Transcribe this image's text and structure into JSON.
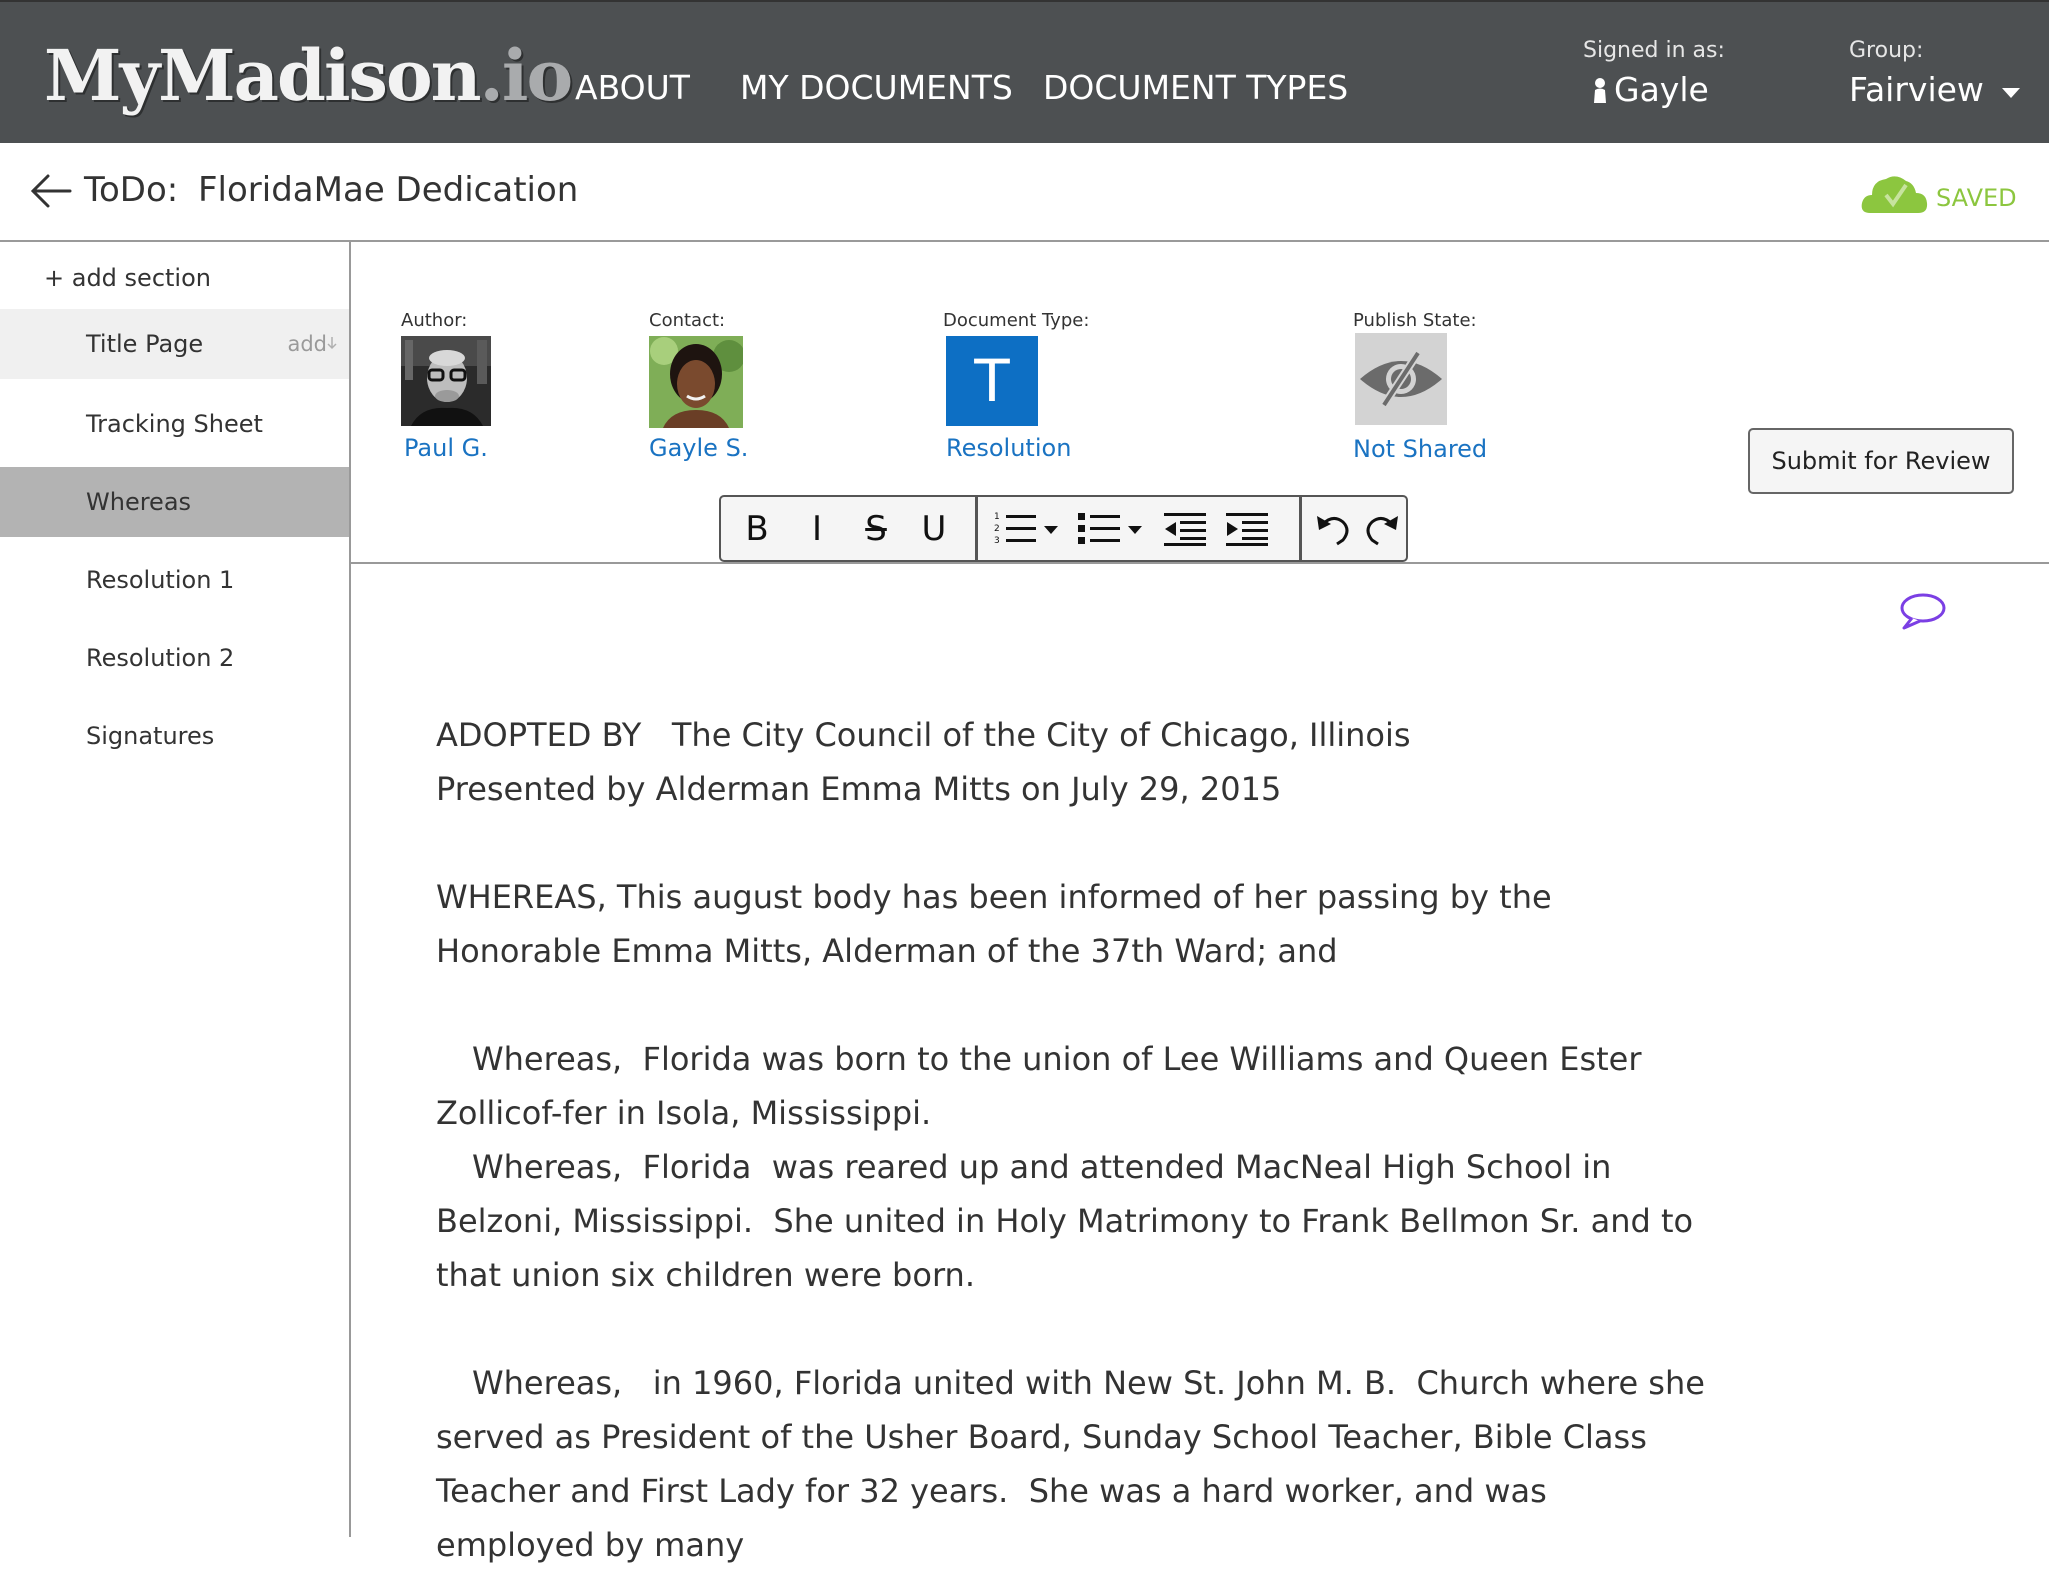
{
  "app": {
    "logo_main": "MyMadison",
    "logo_tld": ".io"
  },
  "nav": {
    "about": "ABOUT",
    "my_documents": "MY DOCUMENTS",
    "document_types": "DOCUMENT TYPES"
  },
  "account": {
    "signed_in_label": "Signed in as:",
    "user_name": "Gayle",
    "group_label": "Group:",
    "group_value": "Fairview"
  },
  "header": {
    "todo_label": "ToDo:",
    "doc_title": "FloridaMae Dedication",
    "save_status": "SAVED"
  },
  "sidebar": {
    "add_section": "+ add section",
    "items": [
      {
        "label": "Title Page",
        "add": "add"
      },
      {
        "label": "Tracking Sheet"
      },
      {
        "label": "Whereas"
      },
      {
        "label": "Resolution 1"
      },
      {
        "label": "Resolution 2"
      },
      {
        "label": "Signatures"
      }
    ]
  },
  "meta": {
    "author_label": "Author:",
    "author_name": "Paul G.",
    "contact_label": "Contact:",
    "contact_name": "Gayle S.",
    "doctype_label": "Document Type:",
    "doctype_letter": "T",
    "doctype_name": "Resolution",
    "publish_label": "Publish State:",
    "publish_state": "Not Shared"
  },
  "actions": {
    "submit": "Submit for Review"
  },
  "toolbar": {
    "bold": "B",
    "italic": "I",
    "strike": "S",
    "underline": "U"
  },
  "document": {
    "adopted_by": "ADOPTED BY   The City Council of the City of Chicago, Illinois",
    "presented_by": "Presented by Alderman Emma Mitts on July 29, 2015",
    "whereas_1": "WHEREAS, This august body has been informed of her passing by the Honorable Emma Mitts, Alderman of the 37th Ward; and",
    "whereas_2": "Whereas,  Florida was born to the union of Lee Williams and Queen Ester Zollicof-fer in Isola, Mississippi.",
    "whereas_3": "Whereas,  Florida  was reared up and attended MacNeal High School in Belzoni, Mississippi.  She united in Holy Matrimony to Frank Bellmon Sr. and to that union six children were born.",
    "whereas_4": "Whereas,   in 1960, Florida united with New St. John M. B.  Church where she served as President of the Usher Board, Sunday School Teacher, Bible Class Teacher and First Lady for 32 years.  She was a hard worker, and was employed by many"
  },
  "colors": {
    "topbar": "#4d5052",
    "link": "#1a73c2",
    "saved": "#8cc63f",
    "doctype": "#0d6fc4",
    "comment": "#7b3fe4",
    "active_section": "#b3b3b3"
  }
}
